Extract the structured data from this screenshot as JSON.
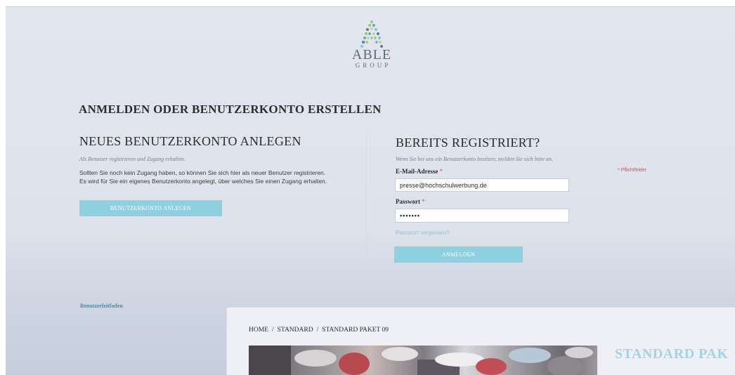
{
  "logo": {
    "wordmark": "ABLE",
    "subtitle": "GROUP"
  },
  "page": {
    "title": "ANMELDEN ODER BENUTZERKONTO ERSTELLEN"
  },
  "new_account": {
    "title": "NEUES BENUTZERKONTO ANLEGEN",
    "subtitle": "Als Benutzer registrieren und Zugang erhalten.",
    "text_line1": "Sollten Sie noch kein Zugang haben, so können Sie sich hier als neuer Benutzer registrieren.",
    "text_line2": "Es wird für Sie ein eigenes Benutzerkonto angelegt, über welches Sie einen Zugang erhalten.",
    "button_label": "BENUTZERKONTO ANLEGEN"
  },
  "login": {
    "title": "BEREITS REGISTRIERT?",
    "subtitle": "Wenn Sie bei uns ein Benutzerkonto besitzen, melden Sie sich bitte an.",
    "email_label": "E-Mail-Adresse",
    "email_value": "presse@hochschulwerbung.de",
    "password_label": "Passwort",
    "password_value": "•••••••",
    "required_marker": "*",
    "required_note": "* Pflichtfelder",
    "forgot_label": "Passwort vergessen?",
    "button_label": "ANMELDEN"
  },
  "footer": {
    "guide_link": "Benutzerleitfaden"
  },
  "product_window": {
    "breadcrumb": [
      "HOME",
      "/",
      "STANDARD",
      "/",
      "STANDARD PAKET 09"
    ],
    "title": "STANDARD PAK"
  },
  "colors": {
    "accent": "#8dd0e0",
    "required": "#e24b4b",
    "link": "#8dc6d8"
  }
}
